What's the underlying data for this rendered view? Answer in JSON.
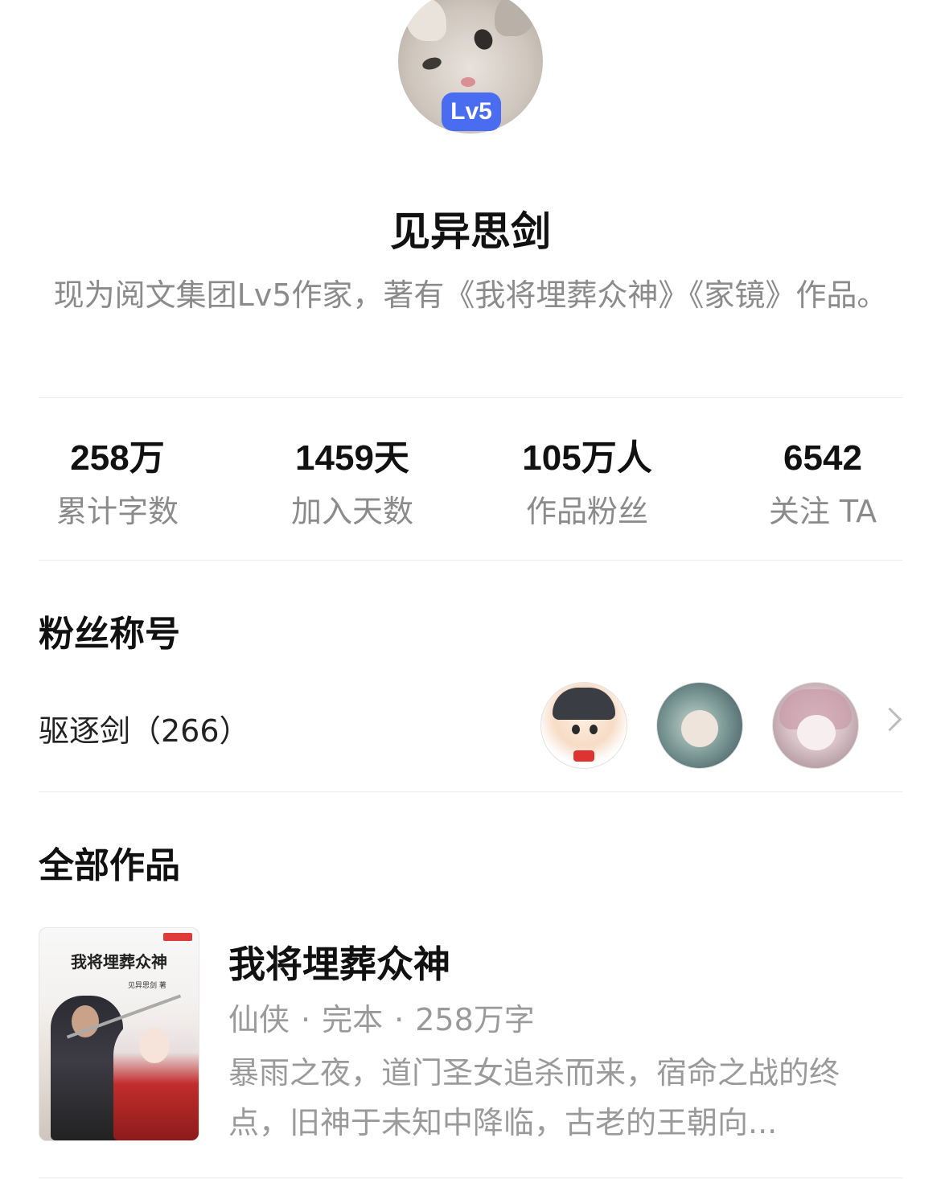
{
  "profile": {
    "level_badge": "Lv5",
    "name": "见异思剑",
    "bio": "现为阅文集团Lv5作家，著有《我将埋葬众神》《家镜》作品。"
  },
  "stats": [
    {
      "value": "258万",
      "label": "累计字数"
    },
    {
      "value": "1459天",
      "label": "加入天数"
    },
    {
      "value": "105万人",
      "label": "作品粉丝"
    },
    {
      "value": "6542",
      "label": "关注 TA"
    }
  ],
  "fan_section": {
    "title": "粉丝称号",
    "fan_title": "驱逐剑（266）"
  },
  "works_section": {
    "title": "全部作品",
    "books": [
      {
        "cover_title": "我将埋葬众神",
        "cover_author": "见异思剑 著",
        "title": "我将埋葬众神",
        "genre": "仙侠",
        "status": "完本",
        "words": "258万字",
        "description": "暴雨之夜，道门圣女追杀而来，宿命之战的终点，旧神于未知中降临，古老的王朝向..."
      }
    ]
  },
  "colors": {
    "accent": "#4a6cf0",
    "text_primary": "#111111",
    "text_secondary": "#8b8b8b"
  }
}
